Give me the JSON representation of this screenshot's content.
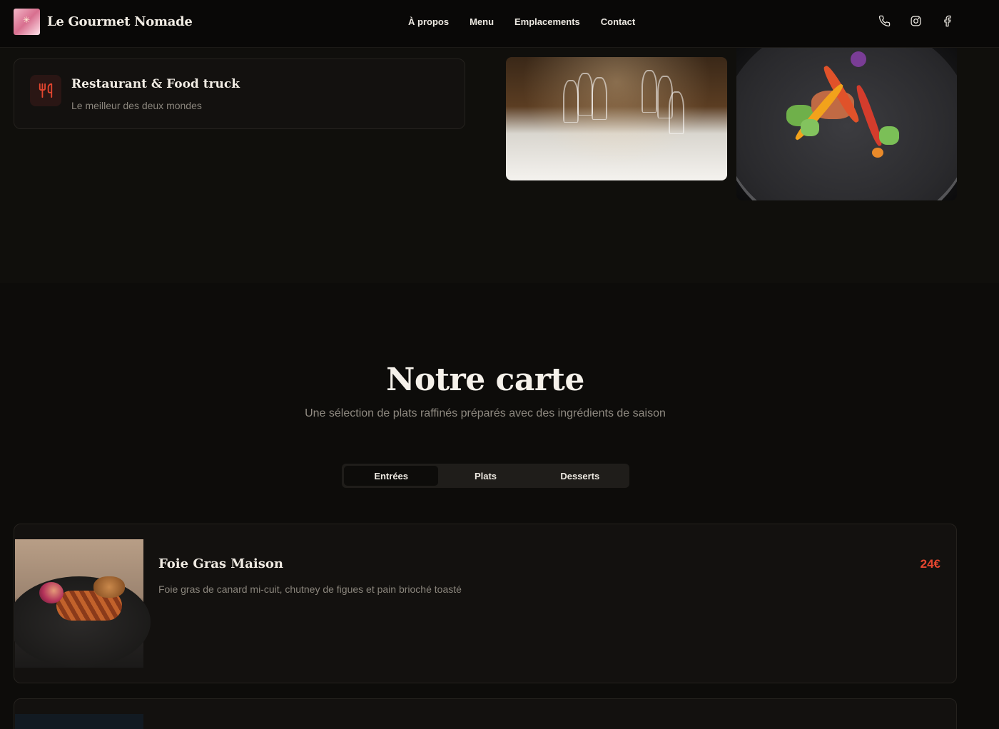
{
  "brand": {
    "name": "Le Gourmet Nomade"
  },
  "nav": {
    "items": [
      {
        "label": "À propos"
      },
      {
        "label": "Menu"
      },
      {
        "label": "Emplacements"
      },
      {
        "label": "Contact"
      }
    ]
  },
  "social": {
    "icons": [
      "phone-icon",
      "instagram-icon",
      "facebook-icon"
    ]
  },
  "feature": {
    "icon": "utensils-icon",
    "title": "Restaurant & Food truck",
    "subtitle": "Le meilleur des deux mondes"
  },
  "menu_section": {
    "title": "Notre carte",
    "subtitle": "Une sélection de plats raffinés préparés avec des ingrédients de saison",
    "tabs": [
      {
        "label": "Entrées",
        "active": true
      },
      {
        "label": "Plats",
        "active": false
      },
      {
        "label": "Desserts",
        "active": false
      }
    ],
    "dishes": [
      {
        "name": "Foie Gras Maison",
        "description": "Foie gras de canard mi-cuit, chutney de figues et pain brioché toasté",
        "price": "24€"
      }
    ]
  },
  "colors": {
    "background": "#0d0c0a",
    "accent": "#e4462f",
    "text": "#ece8e1",
    "muted": "#8a857c"
  }
}
